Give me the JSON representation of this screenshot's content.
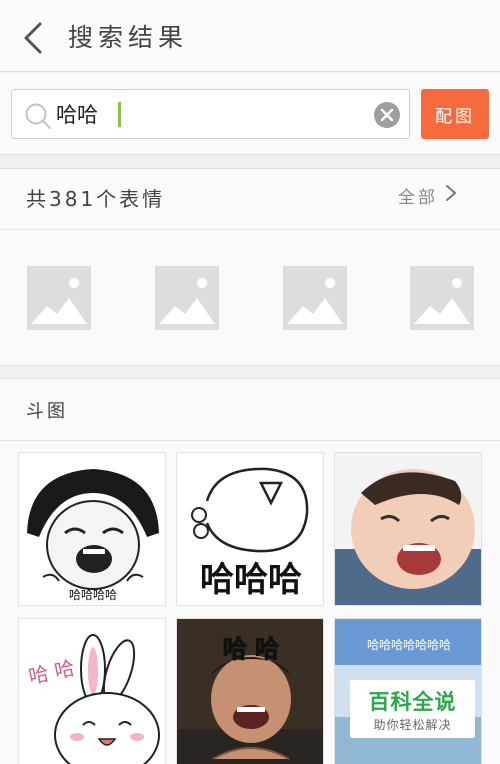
{
  "header": {
    "title": "搜索结果"
  },
  "search": {
    "query": "哈哈",
    "match_button": "配图"
  },
  "results": {
    "count_text": "共381个表情",
    "all_label": "全部"
  },
  "doutu": {
    "title": "斗图",
    "tiles": [
      {
        "caption": "哈哈哈哈"
      },
      {
        "caption": "哈哈哈"
      },
      {
        "caption": ""
      },
      {
        "caption": "哈 哈"
      },
      {
        "caption": "哈 哈"
      },
      {
        "caption": "哈哈哈哈哈哈哈"
      }
    ]
  },
  "watermark": {
    "title": "百科全说",
    "subtitle": "助你轻松解决"
  },
  "colors": {
    "accent": "#f76a3d",
    "caret": "#8bc34a",
    "watermark_green": "#2da54a"
  },
  "icons": [
    "back-arrow-icon",
    "search-icon",
    "clear-icon",
    "chevron-right-icon",
    "image-placeholder-icon"
  ]
}
